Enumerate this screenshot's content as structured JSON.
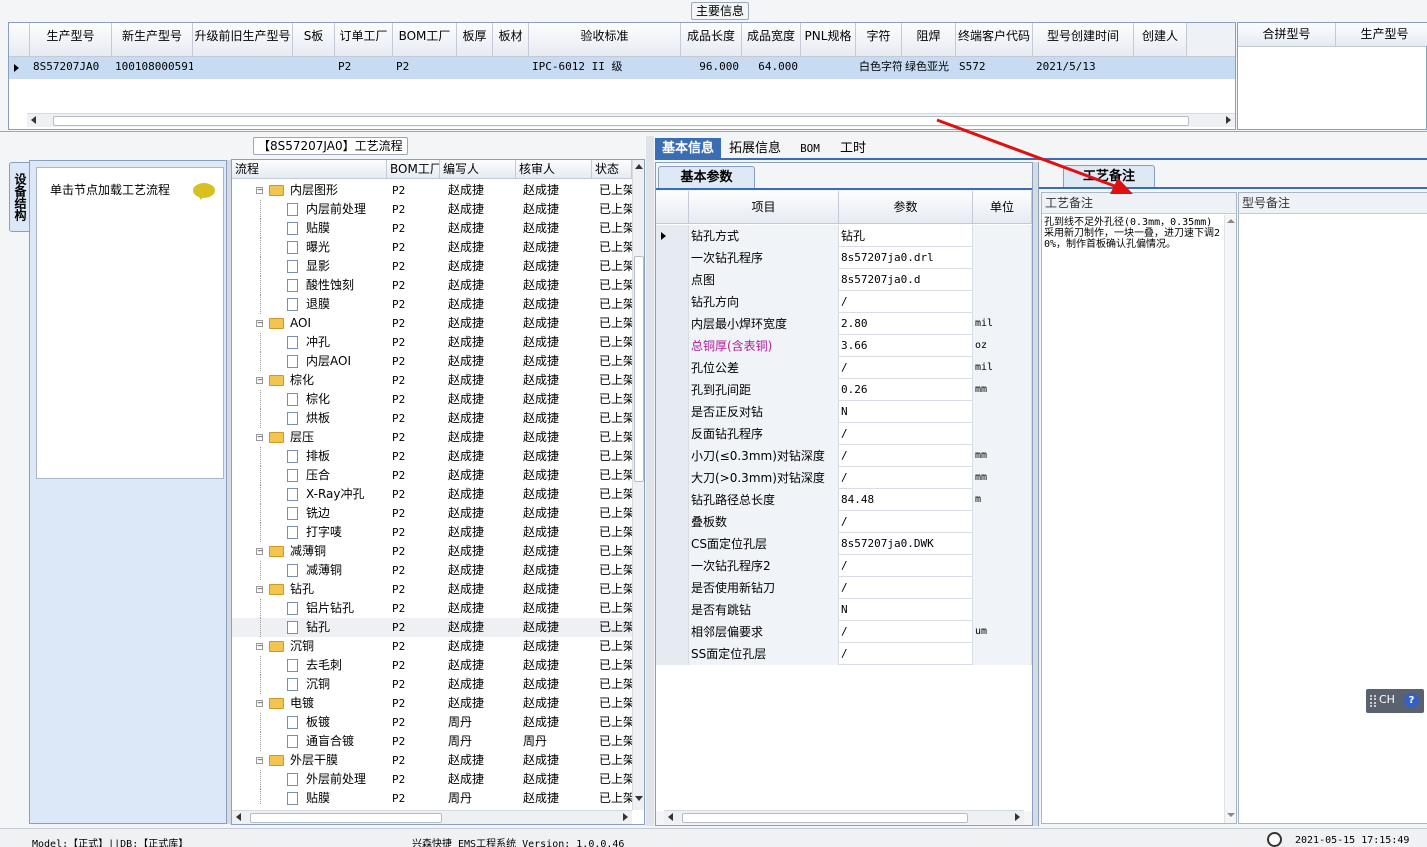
{
  "main_info": {
    "title": "主要信息",
    "columns": [
      "生产型号",
      "新生产型号",
      "升级前旧生产型号",
      "S板",
      "订单工厂",
      "BOM工厂",
      "板厚",
      "板材",
      "验收标准",
      "成品长度",
      "成品宽度",
      "PNL规格",
      "字符",
      "阻焊",
      "终端客户代码",
      "型号创建时间",
      "创建人"
    ],
    "row": [
      "8S57207JA0",
      "10010800059172",
      "",
      "",
      "P2",
      "P2",
      "",
      "",
      "IPC-6012 II 级",
      "96.000",
      "64.000",
      "",
      "白色字符",
      "绿色亚光",
      "S572",
      "2021/5/13",
      ""
    ],
    "side_columns": [
      "合拼型号",
      "生产型号"
    ]
  },
  "process_flow": {
    "title": "【8S57207JA0】工艺流程"
  },
  "left_panel": {
    "tab_label": "设备结构",
    "hint": "单击节点加载工艺流程"
  },
  "tree": {
    "headers": [
      "流程",
      "BOM工厂",
      "编写人",
      "核审人",
      "状态"
    ],
    "rows": [
      {
        "level": 0,
        "name": "内层图形",
        "bom": "P2",
        "writer": "赵成捷",
        "reviewer": "赵成捷",
        "status": "已上架"
      },
      {
        "level": 1,
        "name": "内层前处理",
        "bom": "P2",
        "writer": "赵成捷",
        "reviewer": "赵成捷",
        "status": "已上架"
      },
      {
        "level": 1,
        "name": "贴膜",
        "bom": "P2",
        "writer": "赵成捷",
        "reviewer": "赵成捷",
        "status": "已上架"
      },
      {
        "level": 1,
        "name": "曝光",
        "bom": "P2",
        "writer": "赵成捷",
        "reviewer": "赵成捷",
        "status": "已上架"
      },
      {
        "level": 1,
        "name": "显影",
        "bom": "P2",
        "writer": "赵成捷",
        "reviewer": "赵成捷",
        "status": "已上架"
      },
      {
        "level": 1,
        "name": "酸性蚀刻",
        "bom": "P2",
        "writer": "赵成捷",
        "reviewer": "赵成捷",
        "status": "已上架"
      },
      {
        "level": 1,
        "name": "退膜",
        "bom": "P2",
        "writer": "赵成捷",
        "reviewer": "赵成捷",
        "status": "已上架"
      },
      {
        "level": 0,
        "name": "AOI",
        "bom": "P2",
        "writer": "赵成捷",
        "reviewer": "赵成捷",
        "status": "已上架"
      },
      {
        "level": 1,
        "name": "冲孔",
        "bom": "P2",
        "writer": "赵成捷",
        "reviewer": "赵成捷",
        "status": "已上架"
      },
      {
        "level": 1,
        "name": "内层AOI",
        "bom": "P2",
        "writer": "赵成捷",
        "reviewer": "赵成捷",
        "status": "已上架"
      },
      {
        "level": 0,
        "name": "棕化",
        "bom": "P2",
        "writer": "赵成捷",
        "reviewer": "赵成捷",
        "status": "已上架"
      },
      {
        "level": 1,
        "name": "棕化",
        "bom": "P2",
        "writer": "赵成捷",
        "reviewer": "赵成捷",
        "status": "已上架"
      },
      {
        "level": 1,
        "name": "烘板",
        "bom": "P2",
        "writer": "赵成捷",
        "reviewer": "赵成捷",
        "status": "已上架"
      },
      {
        "level": 0,
        "name": "层压",
        "bom": "P2",
        "writer": "赵成捷",
        "reviewer": "赵成捷",
        "status": "已上架"
      },
      {
        "level": 1,
        "name": "排板",
        "bom": "P2",
        "writer": "赵成捷",
        "reviewer": "赵成捷",
        "status": "已上架"
      },
      {
        "level": 1,
        "name": "压合",
        "bom": "P2",
        "writer": "赵成捷",
        "reviewer": "赵成捷",
        "status": "已上架"
      },
      {
        "level": 1,
        "name": "X-Ray冲孔",
        "bom": "P2",
        "writer": "赵成捷",
        "reviewer": "赵成捷",
        "status": "已上架"
      },
      {
        "level": 1,
        "name": "铣边",
        "bom": "P2",
        "writer": "赵成捷",
        "reviewer": "赵成捷",
        "status": "已上架"
      },
      {
        "level": 1,
        "name": "打字唛",
        "bom": "P2",
        "writer": "赵成捷",
        "reviewer": "赵成捷",
        "status": "已上架"
      },
      {
        "level": 0,
        "name": "减薄铜",
        "bom": "P2",
        "writer": "赵成捷",
        "reviewer": "赵成捷",
        "status": "已上架"
      },
      {
        "level": 1,
        "name": "减薄铜",
        "bom": "P2",
        "writer": "赵成捷",
        "reviewer": "赵成捷",
        "status": "已上架"
      },
      {
        "level": 0,
        "name": "钻孔",
        "bom": "P2",
        "writer": "赵成捷",
        "reviewer": "赵成捷",
        "status": "已上架"
      },
      {
        "level": 1,
        "name": "铝片钻孔",
        "bom": "P2",
        "writer": "赵成捷",
        "reviewer": "赵成捷",
        "status": "已上架"
      },
      {
        "level": 1,
        "name": "钻孔",
        "bom": "P2",
        "writer": "赵成捷",
        "reviewer": "赵成捷",
        "status": "已上架",
        "selected": true
      },
      {
        "level": 0,
        "name": "沉铜",
        "bom": "P2",
        "writer": "赵成捷",
        "reviewer": "赵成捷",
        "status": "已上架"
      },
      {
        "level": 1,
        "name": "去毛刺",
        "bom": "P2",
        "writer": "赵成捷",
        "reviewer": "赵成捷",
        "status": "已上架"
      },
      {
        "level": 1,
        "name": "沉铜",
        "bom": "P2",
        "writer": "赵成捷",
        "reviewer": "赵成捷",
        "status": "已上架"
      },
      {
        "level": 0,
        "name": "电镀",
        "bom": "P2",
        "writer": "赵成捷",
        "reviewer": "赵成捷",
        "status": "已上架"
      },
      {
        "level": 1,
        "name": "板镀",
        "bom": "P2",
        "writer": "周丹",
        "reviewer": "赵成捷",
        "status": "已上架"
      },
      {
        "level": 1,
        "name": "通盲合镀",
        "bom": "P2",
        "writer": "周丹",
        "reviewer": "周丹",
        "status": "已上架"
      },
      {
        "level": 0,
        "name": "外层干膜",
        "bom": "P2",
        "writer": "赵成捷",
        "reviewer": "赵成捷",
        "status": "已上架"
      },
      {
        "level": 1,
        "name": "外层前处理",
        "bom": "P2",
        "writer": "赵成捷",
        "reviewer": "赵成捷",
        "status": "已上架"
      },
      {
        "level": 1,
        "name": "贴膜",
        "bom": "P2",
        "writer": "周丹",
        "reviewer": "赵成捷",
        "status": "已上架"
      }
    ]
  },
  "detail_tabs": [
    "基本信息",
    "拓展信息",
    "BOM",
    "工时"
  ],
  "params": {
    "subtab": "基本参数",
    "headers": [
      "项目",
      "参数",
      "单位"
    ],
    "rows": [
      {
        "item": "钻孔方式",
        "value": "钻孔",
        "unit": "",
        "current": true
      },
      {
        "item": "一次钻孔程序",
        "value": "8s57207ja0.drl",
        "unit": ""
      },
      {
        "item": "点图",
        "value": "8s57207ja0.d",
        "unit": ""
      },
      {
        "item": "钻孔方向",
        "value": "/",
        "unit": ""
      },
      {
        "item": "内层最小焊环宽度",
        "value": "2.80",
        "unit": "mil"
      },
      {
        "item": "总铜厚(含表铜)",
        "value": "3.66",
        "unit": "oz",
        "highlight": true
      },
      {
        "item": "孔位公差",
        "value": "/",
        "unit": "mil"
      },
      {
        "item": "孔到孔间距",
        "value": "0.26",
        "unit": "mm"
      },
      {
        "item": "是否正反对钻",
        "value": "N",
        "unit": ""
      },
      {
        "item": "反面钻孔程序",
        "value": "/",
        "unit": ""
      },
      {
        "item": "小刀(≤0.3mm)对钻深度",
        "value": "/",
        "unit": "mm"
      },
      {
        "item": "大刀(>0.3mm)对钻深度",
        "value": "/",
        "unit": "mm"
      },
      {
        "item": "钻孔路径总长度",
        "value": "84.48",
        "unit": "m"
      },
      {
        "item": "叠板数",
        "value": "/",
        "unit": ""
      },
      {
        "item": "CS面定位孔层",
        "value": "8s57207ja0.DWK",
        "unit": ""
      },
      {
        "item": "一次钻孔程序2",
        "value": "/",
        "unit": ""
      },
      {
        "item": "是否使用新钻刀",
        "value": "/",
        "unit": ""
      },
      {
        "item": "是否有跳钻",
        "value": "N",
        "unit": ""
      },
      {
        "item": "相邻层偏要求",
        "value": "/",
        "unit": "um"
      },
      {
        "item": "SS面定位孔层",
        "value": "/",
        "unit": ""
      }
    ]
  },
  "remarks": {
    "tab": "工艺备注",
    "process_label": "工艺备注",
    "model_label": "型号备注",
    "process_text": "孔到线不足外孔径(0.3mm，0.35mm)采用新刀制作，一块一叠，进刀速下调20%，制作首板确认孔偏情况。"
  },
  "ime": {
    "label": "CH",
    "help": "?"
  },
  "status_bar": {
    "model": "Model:【正式】||DB:【正式库】",
    "app": "兴森快捷 EMS工程系统 Version: 1.0.0.46",
    "datetime": "2021-05-15 17:15:49"
  }
}
